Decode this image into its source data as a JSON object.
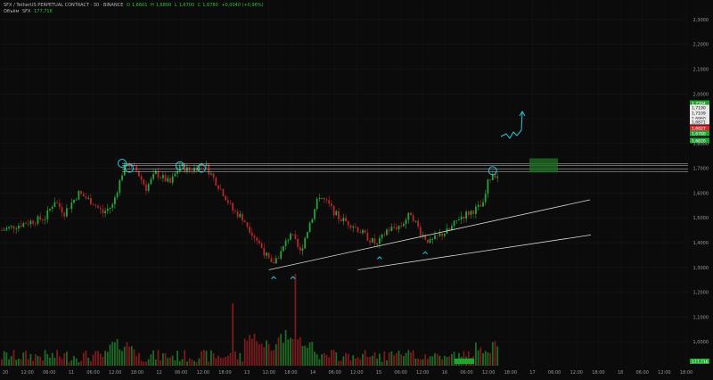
{
  "header": {
    "symbol_line": "SFX / TetherUS PERPETUAL CONTRACT · 30 · BINANCE",
    "ohlc": [
      {
        "label": "O",
        "value": "1,6601"
      },
      {
        "label": "H",
        "value": "1,6800"
      },
      {
        "label": "L",
        "value": "1,6700"
      },
      {
        "label": "C",
        "value": "1,6780"
      }
    ],
    "change": "+0,0040 (+0,96%)",
    "volume_label": "Объём",
    "volume_symbol": "SFX",
    "volume_value": "177,71K"
  },
  "colors": {
    "bull": "#26a43a",
    "bear": "#b3262a",
    "trendline": "#d8d8d8",
    "marker": "#28c8d8",
    "target_box": "#1f6b23"
  },
  "chart_data": {
    "type": "candlestick",
    "ylim": [
      0.95,
      2.35
    ],
    "y_ticks": [
      "2,3000",
      "2,2000",
      "2,1000",
      "2,0000",
      "1,9000",
      "1,8000",
      "1,7000",
      "1,6000",
      "1,5000",
      "1,4000",
      "1,3000",
      "1,2000",
      "1,1000",
      "1,0000"
    ],
    "x_ticks": [
      "20",
      "12:00",
      "06:00",
      "11",
      "06:00",
      "12:00",
      "18:00",
      "12",
      "06:00",
      "12:00",
      "18:00",
      "13",
      "12:00",
      "18:00",
      "14",
      "06:00",
      "12:00",
      "15",
      "06:00",
      "12:00",
      "16",
      "06:00",
      "12:00",
      "18:00",
      "17",
      "06:00",
      "12:00",
      "18:00",
      "18",
      "06:00",
      "12:00",
      "18:00"
    ],
    "price_tags": [
      {
        "value": "1,7394",
        "kind": "green"
      },
      {
        "value": "1,7190",
        "kind": "white"
      },
      {
        "value": "1,7109",
        "kind": "white"
      },
      {
        "value": "1,6960",
        "kind": "white"
      },
      {
        "value": "1,6871",
        "kind": "white"
      },
      {
        "value": "1,6827",
        "kind": "red"
      },
      {
        "value": "1,6780",
        "kind": "green"
      },
      {
        "value": "1,6620",
        "kind": "green"
      }
    ],
    "volume_tag": "177,71K",
    "resistance_levels": [
      1.719,
      1.711,
      1.696,
      1.687
    ],
    "trendline": {
      "from": {
        "x_index": 148,
        "price": 1.29
      },
      "to": {
        "x_index": 330,
        "price": 1.474
      }
    },
    "target": {
      "price_low": 1.683,
      "price_high": 1.74
    }
  }
}
